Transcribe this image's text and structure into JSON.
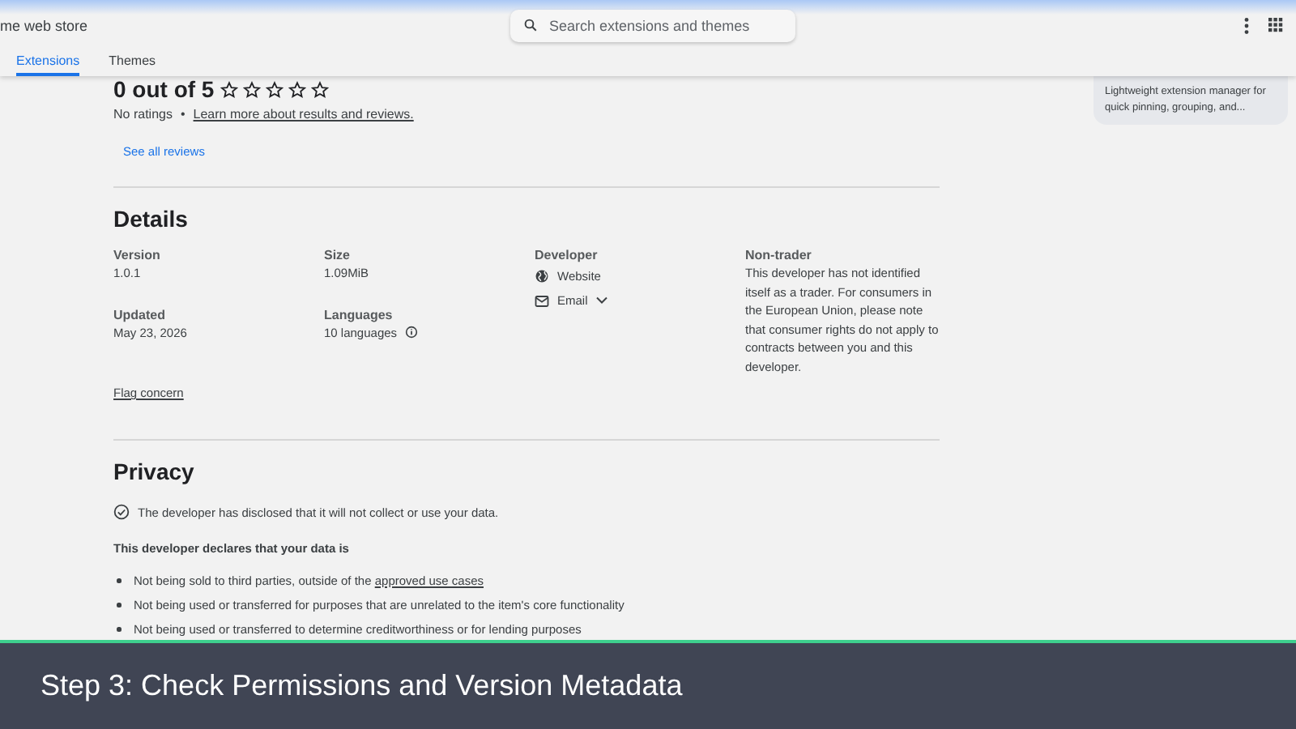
{
  "header": {
    "store_title": "me web store",
    "search": {
      "placeholder": "Search extensions and themes"
    }
  },
  "tabs": [
    {
      "label": "Extensions",
      "selected": true
    },
    {
      "label": "Themes",
      "selected": false
    }
  ],
  "side_card": {
    "description": "Lightweight extension manager for quick pinning, grouping, and..."
  },
  "rating": {
    "summary": "0 out of 5",
    "stars": 0,
    "no_ratings": "No ratings",
    "separator": "•",
    "learn_more": "Learn more about results and reviews.",
    "see_all": "See all reviews"
  },
  "details": {
    "title": "Details",
    "columns": [
      {
        "items": [
          {
            "label": "Version",
            "value": "1.0.1"
          },
          {
            "label": "Updated",
            "value": "May 23, 2026"
          }
        ]
      },
      {
        "items": [
          {
            "label": "Size",
            "value": "1.09MiB"
          },
          {
            "label": "Languages",
            "value": "10 languages",
            "kind": "info"
          }
        ]
      },
      {
        "items": [
          {
            "label": "Developer",
            "links": [
              {
                "label": "Website",
                "kind": "website"
              },
              {
                "label": "Email",
                "kind": "email"
              }
            ]
          }
        ]
      },
      {
        "items": [
          {
            "label": "Non-trader",
            "value": "This developer has not identified itself as a trader. For consumers in the European Union, please note that consumer rights do not apply to contracts between you and this developer."
          }
        ]
      }
    ],
    "flag": "Flag concern"
  },
  "privacy": {
    "title": "Privacy",
    "disclosure": "The developer has disclosed that it will not collect or use your data.",
    "declares": "This developer declares that your data is",
    "bullets": [
      {
        "text": "Not being sold to third parties, outside of the",
        "link": "approved use cases"
      },
      {
        "text": "Not being used or transferred for purposes that are unrelated to the item's core functionality"
      },
      {
        "text": "Not being used or transferred to determine creditworthiness or for lending purposes"
      }
    ]
  },
  "caption": "Step 3: Check Permissions and Version Metadata"
}
